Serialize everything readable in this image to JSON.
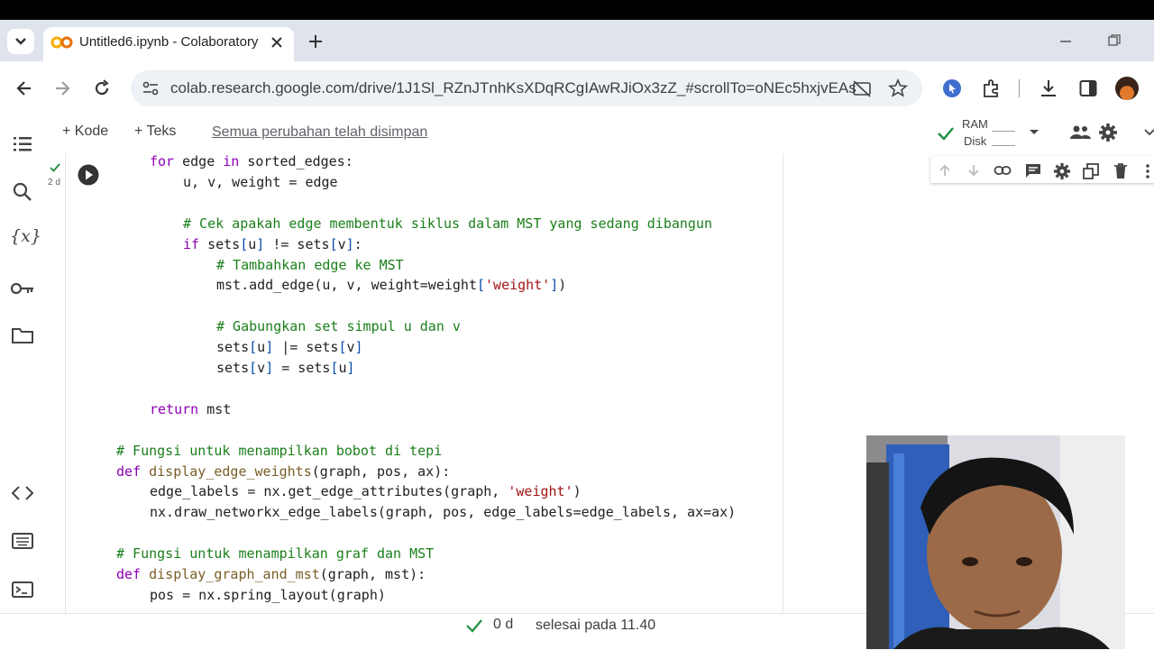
{
  "browser": {
    "tab_title": "Untitled6.ipynb - Colaboratory",
    "url": "colab.research.google.com/drive/1J1Sl_RZnJTnhKsXDqRCgIAwRJiOx3zZ_#scrollTo=oNEc5hxjvEAs"
  },
  "colab": {
    "add_code": "+ Kode",
    "add_text": "+ Teks",
    "save_status": "Semua perubahan telah disimpan",
    "ram_label": "RAM",
    "disk_label": "Disk",
    "cell_exec_time": "2 d"
  },
  "code_lines": [
    {
      "t": "for edge in sorted_edges:"
    },
    {
      "t": "u, v, weight = edge"
    },
    {
      "t": ""
    },
    {
      "t": "# Cek apakah edge membentuk siklus dalam MST yang sedang dibangun"
    },
    {
      "t": "if sets[u] != sets[v]:"
    },
    {
      "t": "# Tambahkan edge ke MST"
    },
    {
      "t": "mst.add_edge(u, v, weight=weight['weight'])"
    },
    {
      "t": ""
    },
    {
      "t": "# Gabungkan set simpul u dan v"
    },
    {
      "t": "sets[u] |= sets[v]"
    },
    {
      "t": "sets[v] = sets[u]"
    },
    {
      "t": ""
    },
    {
      "t": "return mst"
    },
    {
      "t": ""
    },
    {
      "t": "# Fungsi untuk menampilkan bobot di tepi"
    },
    {
      "t": "def display_edge_weights(graph, pos, ax):"
    },
    {
      "t": "edge_labels = nx.get_edge_attributes(graph, 'weight')"
    },
    {
      "t": "nx.draw_networkx_edge_labels(graph, pos, edge_labels=edge_labels, ax=ax)"
    },
    {
      "t": ""
    },
    {
      "t": "# Fungsi untuk menampilkan graf dan MST"
    },
    {
      "t": "def display_graph_and_mst(graph, mst):"
    },
    {
      "t": "pos = nx.spring_layout(graph)"
    }
  ],
  "status": {
    "elapsed": "0 d",
    "finished": "selesai pada 11.40"
  }
}
